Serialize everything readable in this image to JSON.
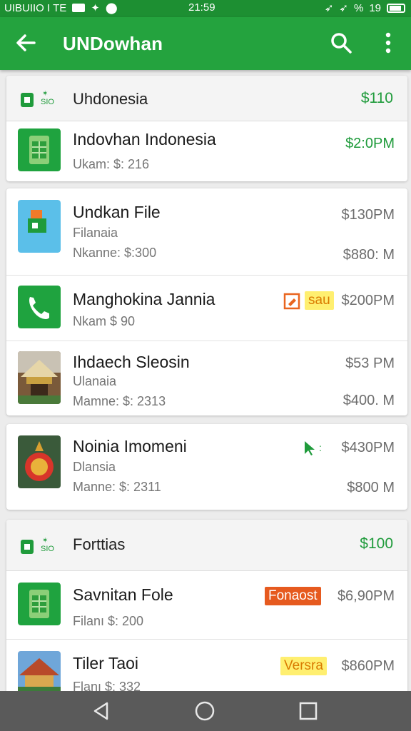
{
  "status_bar": {
    "left_text": "UIBUIIO I TE",
    "time": "21:59",
    "battery": "19"
  },
  "app_bar": {
    "title": "UNDowhan"
  },
  "sections": [
    {
      "title": "Uhdonesia",
      "amount": "$110",
      "icon_tag": "SIO",
      "items": [
        {
          "title": "Ιndovhan Indonesia",
          "subtitle": "",
          "meta": "Ukam: $: 216",
          "time": "$2:0PM",
          "time_color": "green",
          "amount": "",
          "badge": "",
          "badge_style": "",
          "thumb": "sim-card-icon"
        }
      ]
    },
    {
      "title": "",
      "amount": "",
      "items": [
        {
          "title": "Undkan File",
          "subtitle": "Filanaia",
          "meta": "Nkanne: $:300",
          "time": "$130PM",
          "amount": "$880: M",
          "badge": "",
          "thumb": "phone-app-icon"
        },
        {
          "title": "Manghokina Jannia",
          "subtitle": "",
          "meta": "Nkam $ 90",
          "time": "$200PM",
          "amount": "",
          "badge": "sau",
          "badge_style": "yellow",
          "thumb": "phone-call-icon"
        },
        {
          "title": "Ιhdaech Sleosin",
          "subtitle": "Ulanaia",
          "meta": "Mamne: $: 2313",
          "time": "$53 PM",
          "amount": "$400. M",
          "badge": "",
          "thumb": "temple-photo"
        },
        {
          "title": "Noinia Imomeni",
          "subtitle": "Dlansia",
          "meta": "Manne: $: 2311",
          "time": "$430PM",
          "amount": "$800 M",
          "badge": "",
          "thumb": "emblem-photo"
        }
      ]
    },
    {
      "title": "Forttias",
      "amount": "$100",
      "icon_tag": "SIO",
      "items": [
        {
          "title": "Savnitan Fole",
          "subtitle": "",
          "meta": "Filanı $: 200",
          "time": "$6,90PM",
          "amount": "",
          "badge": "Fonaost",
          "badge_style": "red",
          "thumb": "sim-card-icon"
        },
        {
          "title": "Tiler Taoi",
          "subtitle": "",
          "meta": "Flanı $: 332",
          "time": "$860PM",
          "amount": "",
          "badge": "Versra",
          "badge_style": "yellow",
          "thumb": "pagoda-photo"
        }
      ]
    }
  ],
  "colors": {
    "primary": "#24a33e",
    "status": "#1d8f32",
    "accent_green": "#1f9b3b",
    "badge_yellow": "#ffef70",
    "badge_red": "#e65a1f",
    "nav_bar": "#5a5a5a"
  }
}
